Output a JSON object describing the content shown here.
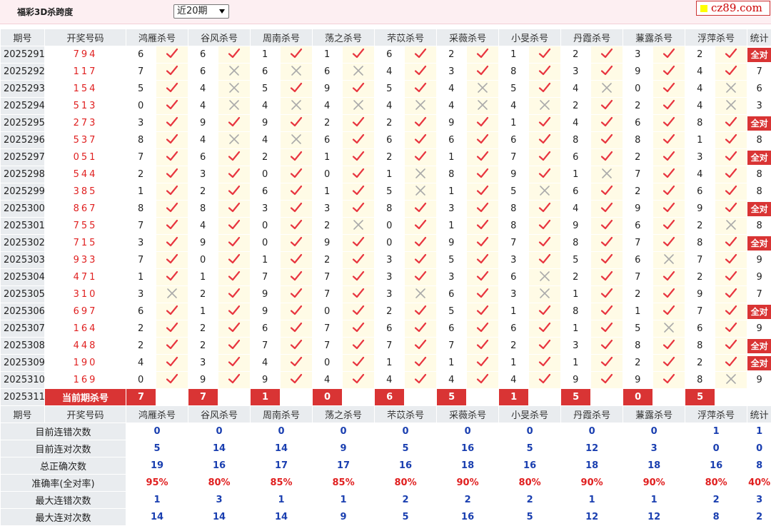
{
  "header": {
    "title": "福彩3D杀跨度",
    "period_select": "近20期",
    "logo": "cz89.com"
  },
  "columns": {
    "issue": "期号",
    "draw": "开奖号码",
    "experts": [
      "鸿雁杀号",
      "谷风杀号",
      "周南杀号",
      "荡之杀号",
      "芣苡杀号",
      "采薇杀号",
      "小旻杀号",
      "丹霞杀号",
      "蒹露杀号",
      "浮萍杀号"
    ],
    "stat": "统计"
  },
  "rows": [
    {
      "issue": "2025291",
      "draw": "794",
      "kills": [
        6,
        6,
        1,
        1,
        6,
        2,
        1,
        2,
        3,
        2
      ],
      "ok": [
        1,
        1,
        1,
        1,
        1,
        1,
        1,
        1,
        1,
        1
      ],
      "stat": "全对"
    },
    {
      "issue": "2025292",
      "draw": "117",
      "kills": [
        7,
        6,
        6,
        6,
        4,
        3,
        8,
        3,
        9,
        4
      ],
      "ok": [
        1,
        0,
        0,
        0,
        1,
        1,
        1,
        1,
        1,
        1
      ],
      "stat": "7"
    },
    {
      "issue": "2025293",
      "draw": "154",
      "kills": [
        5,
        4,
        5,
        9,
        5,
        4,
        5,
        4,
        0,
        4
      ],
      "ok": [
        1,
        0,
        1,
        1,
        1,
        0,
        1,
        0,
        1,
        0
      ],
      "stat": "6"
    },
    {
      "issue": "2025294",
      "draw": "513",
      "kills": [
        0,
        4,
        4,
        4,
        4,
        4,
        4,
        2,
        2,
        4
      ],
      "ok": [
        1,
        0,
        0,
        0,
        0,
        0,
        0,
        1,
        1,
        0
      ],
      "stat": "3"
    },
    {
      "issue": "2025295",
      "draw": "273",
      "kills": [
        3,
        9,
        9,
        2,
        2,
        9,
        1,
        4,
        6,
        8
      ],
      "ok": [
        1,
        1,
        1,
        1,
        1,
        1,
        1,
        1,
        1,
        1
      ],
      "stat": "全对"
    },
    {
      "issue": "2025296",
      "draw": "537",
      "kills": [
        8,
        4,
        4,
        6,
        6,
        6,
        6,
        8,
        8,
        1
      ],
      "ok": [
        1,
        0,
        0,
        1,
        1,
        1,
        1,
        1,
        1,
        1
      ],
      "stat": "8"
    },
    {
      "issue": "2025297",
      "draw": "051",
      "kills": [
        7,
        6,
        2,
        1,
        2,
        1,
        7,
        6,
        2,
        3
      ],
      "ok": [
        1,
        1,
        1,
        1,
        1,
        1,
        1,
        1,
        1,
        1
      ],
      "stat": "全对"
    },
    {
      "issue": "2025298",
      "draw": "544",
      "kills": [
        2,
        3,
        0,
        0,
        1,
        8,
        9,
        1,
        7,
        4
      ],
      "ok": [
        1,
        1,
        1,
        1,
        0,
        1,
        1,
        0,
        1,
        1
      ],
      "stat": "8"
    },
    {
      "issue": "2025299",
      "draw": "385",
      "kills": [
        1,
        2,
        6,
        1,
        5,
        1,
        5,
        6,
        2,
        6
      ],
      "ok": [
        1,
        1,
        1,
        1,
        0,
        1,
        0,
        1,
        1,
        1
      ],
      "stat": "8"
    },
    {
      "issue": "2025300",
      "draw": "867",
      "kills": [
        8,
        8,
        3,
        3,
        8,
        3,
        8,
        4,
        9,
        9
      ],
      "ok": [
        1,
        1,
        1,
        1,
        1,
        1,
        1,
        1,
        1,
        1
      ],
      "stat": "全对"
    },
    {
      "issue": "2025301",
      "draw": "755",
      "kills": [
        7,
        4,
        0,
        2,
        0,
        1,
        8,
        9,
        6,
        2
      ],
      "ok": [
        1,
        1,
        1,
        0,
        1,
        1,
        1,
        1,
        1,
        0
      ],
      "stat": "8"
    },
    {
      "issue": "2025302",
      "draw": "715",
      "kills": [
        3,
        9,
        0,
        9,
        0,
        9,
        7,
        8,
        7,
        8
      ],
      "ok": [
        1,
        1,
        1,
        1,
        1,
        1,
        1,
        1,
        1,
        1
      ],
      "stat": "全对"
    },
    {
      "issue": "2025303",
      "draw": "933",
      "kills": [
        7,
        0,
        1,
        2,
        3,
        5,
        3,
        5,
        6,
        7
      ],
      "ok": [
        1,
        1,
        1,
        1,
        1,
        1,
        1,
        1,
        0,
        1
      ],
      "stat": "9"
    },
    {
      "issue": "2025304",
      "draw": "471",
      "kills": [
        1,
        1,
        7,
        7,
        3,
        3,
        6,
        2,
        7,
        2
      ],
      "ok": [
        1,
        1,
        1,
        1,
        1,
        1,
        0,
        1,
        1,
        1
      ],
      "stat": "9"
    },
    {
      "issue": "2025305",
      "draw": "310",
      "kills": [
        3,
        2,
        9,
        7,
        3,
        6,
        3,
        1,
        2,
        9
      ],
      "ok": [
        0,
        1,
        1,
        1,
        0,
        1,
        0,
        1,
        1,
        1
      ],
      "stat": "7"
    },
    {
      "issue": "2025306",
      "draw": "697",
      "kills": [
        6,
        1,
        9,
        0,
        2,
        5,
        1,
        8,
        1,
        7
      ],
      "ok": [
        1,
        1,
        1,
        1,
        1,
        1,
        1,
        1,
        1,
        1
      ],
      "stat": "全对"
    },
    {
      "issue": "2025307",
      "draw": "164",
      "kills": [
        2,
        2,
        6,
        7,
        6,
        6,
        6,
        1,
        5,
        6
      ],
      "ok": [
        1,
        1,
        1,
        1,
        1,
        1,
        1,
        1,
        0,
        1
      ],
      "stat": "9"
    },
    {
      "issue": "2025308",
      "draw": "448",
      "kills": [
        2,
        2,
        7,
        7,
        7,
        7,
        2,
        3,
        8,
        8
      ],
      "ok": [
        1,
        1,
        1,
        1,
        1,
        1,
        1,
        1,
        1,
        1
      ],
      "stat": "全对"
    },
    {
      "issue": "2025309",
      "draw": "190",
      "kills": [
        4,
        3,
        4,
        0,
        1,
        1,
        1,
        1,
        2,
        2
      ],
      "ok": [
        1,
        1,
        1,
        1,
        1,
        1,
        1,
        1,
        1,
        1
      ],
      "stat": "全对"
    },
    {
      "issue": "2025310",
      "draw": "169",
      "kills": [
        0,
        9,
        9,
        4,
        4,
        4,
        4,
        9,
        9,
        8
      ],
      "ok": [
        1,
        1,
        1,
        1,
        1,
        1,
        1,
        1,
        1,
        0
      ],
      "stat": "9"
    }
  ],
  "current": {
    "issue": "2025311",
    "label": "当前期杀号",
    "kills": [
      7,
      7,
      1,
      0,
      6,
      5,
      1,
      5,
      0,
      5
    ]
  },
  "summary": [
    {
      "label": "目前连错次数",
      "values": [
        "0",
        "0",
        "0",
        "0",
        "0",
        "0",
        "0",
        "0",
        "0",
        "1"
      ],
      "stat": "1"
    },
    {
      "label": "目前连对次数",
      "values": [
        "5",
        "14",
        "14",
        "9",
        "5",
        "16",
        "5",
        "12",
        "3",
        "0"
      ],
      "stat": "0"
    },
    {
      "label": "总正确次数",
      "values": [
        "19",
        "16",
        "17",
        "17",
        "16",
        "18",
        "16",
        "18",
        "18",
        "16"
      ],
      "stat": "8"
    },
    {
      "label": "准确率(全对率)",
      "values": [
        "95%",
        "80%",
        "85%",
        "85%",
        "80%",
        "90%",
        "80%",
        "90%",
        "90%",
        "80%"
      ],
      "stat": "40%",
      "red": true
    },
    {
      "label": "最大连错次数",
      "values": [
        "1",
        "3",
        "1",
        "1",
        "2",
        "2",
        "2",
        "1",
        "1",
        "2"
      ],
      "stat": "3"
    },
    {
      "label": "最大连对次数",
      "values": [
        "14",
        "14",
        "14",
        "9",
        "5",
        "16",
        "5",
        "12",
        "12",
        "8"
      ],
      "stat": "2"
    }
  ]
}
